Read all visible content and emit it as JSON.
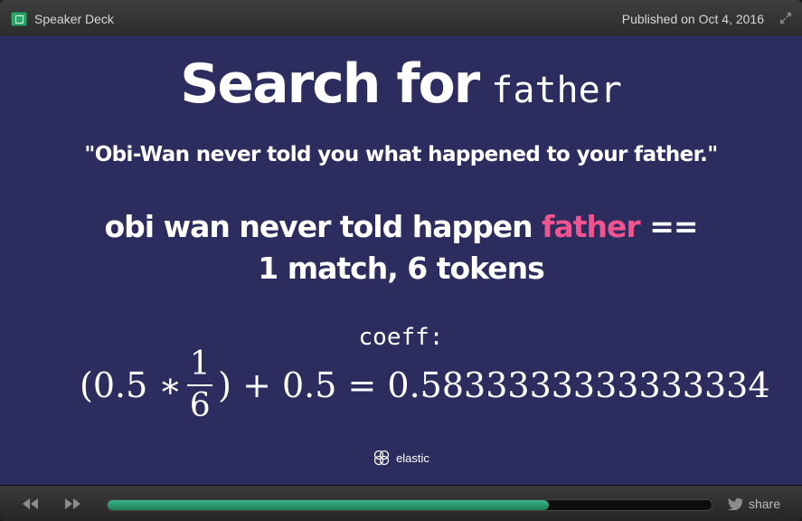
{
  "header": {
    "brand_label": "Speaker Deck",
    "published_text": "Published on Oct 4, 2016"
  },
  "slide": {
    "title_bold": "Search for",
    "title_mono": "father",
    "quote": "\"Obi-Wan never told you what happened to your father.\"",
    "tokens_text": "obi wan never told happen",
    "tokens_highlight": "father",
    "tokens_operator": "==",
    "match_text": "1 match, 6 tokens",
    "coeff_label": "coeff:",
    "formula": {
      "open": "(0.5 ∗",
      "numerator": "1",
      "denominator": "6",
      "rest": ") + 0.5 = 0.5833333333333334"
    },
    "logo_text": "elastic"
  },
  "controls": {
    "share_label": "share",
    "progress_fraction": 0.73
  },
  "colors": {
    "slide_background": "#2d2c5f",
    "highlight": "#f0548e",
    "progress": "#2ea274"
  },
  "icons": [
    "speakerdeck-logo-icon",
    "expand-icon",
    "rewind-icon",
    "fast-forward-icon",
    "twitter-bird-icon",
    "elastic-logo-icon"
  ]
}
